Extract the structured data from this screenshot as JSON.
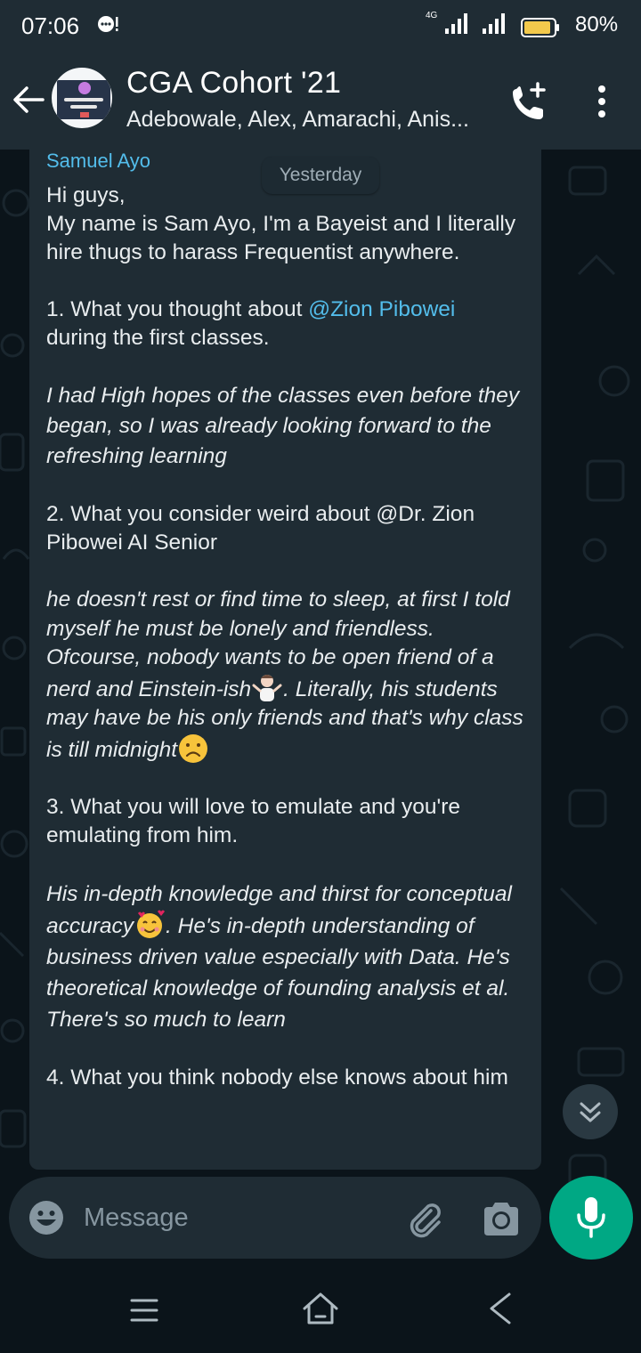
{
  "status_bar": {
    "time": "07:06",
    "network": "4G",
    "battery": "80%"
  },
  "header": {
    "title": "CGA Cohort '21",
    "subtitle": "Adebowale, Alex, Amarachi, Anis...",
    "avatar_text": "CGA Cohort"
  },
  "chat": {
    "date_chip": "Yesterday",
    "sender": "Samuel Ayo",
    "greeting": "Hi guys,",
    "intro": "My name is Sam Ayo, I'm a Bayeist and I literally hire thugs to harass Frequentist anywhere.",
    "q1_prefix": "1. What you thought about ",
    "q1_mention": "@Zion Pibowei",
    "q1_suffix": "during the first classes.",
    "a1": "I had High hopes of the classes even before they began, so I was already looking forward to the refreshing learning",
    "q2": "2. What you consider weird about @Dr. Zion Pibowei AI Senior",
    "a2_part1": "he doesn't rest or find time to sleep, at first I told myself he must be lonely and friendless. Ofcourse, nobody wants to be open friend of a nerd and Einstein-ish",
    "a2_part2": ". Literally, his students may have be his only friends and that's why class is till midnight",
    "q3": "3. What you will love to emulate and you're emulating from him.",
    "a3_part1": "His in-depth knowledge and thirst for conceptual accuracy",
    "a3_part2": ". He's in-depth understanding of business driven value especially with Data. He's theoretical knowledge of founding analysis et al. There's so much to learn",
    "q4": "4. What you think nobody else knows about him"
  },
  "input": {
    "placeholder": "Message"
  },
  "colors": {
    "accent": "#00a884",
    "mention": "#53bdeb",
    "bubble": "#1f2c34",
    "background": "#0b141a"
  },
  "icons": [
    "back-arrow-icon",
    "add-call-icon",
    "more-options-icon",
    "chevrons-down-icon",
    "emoji-icon",
    "paperclip-icon",
    "camera-icon",
    "mic-icon",
    "nav-menu-icon",
    "nav-home-icon",
    "nav-back-icon"
  ]
}
